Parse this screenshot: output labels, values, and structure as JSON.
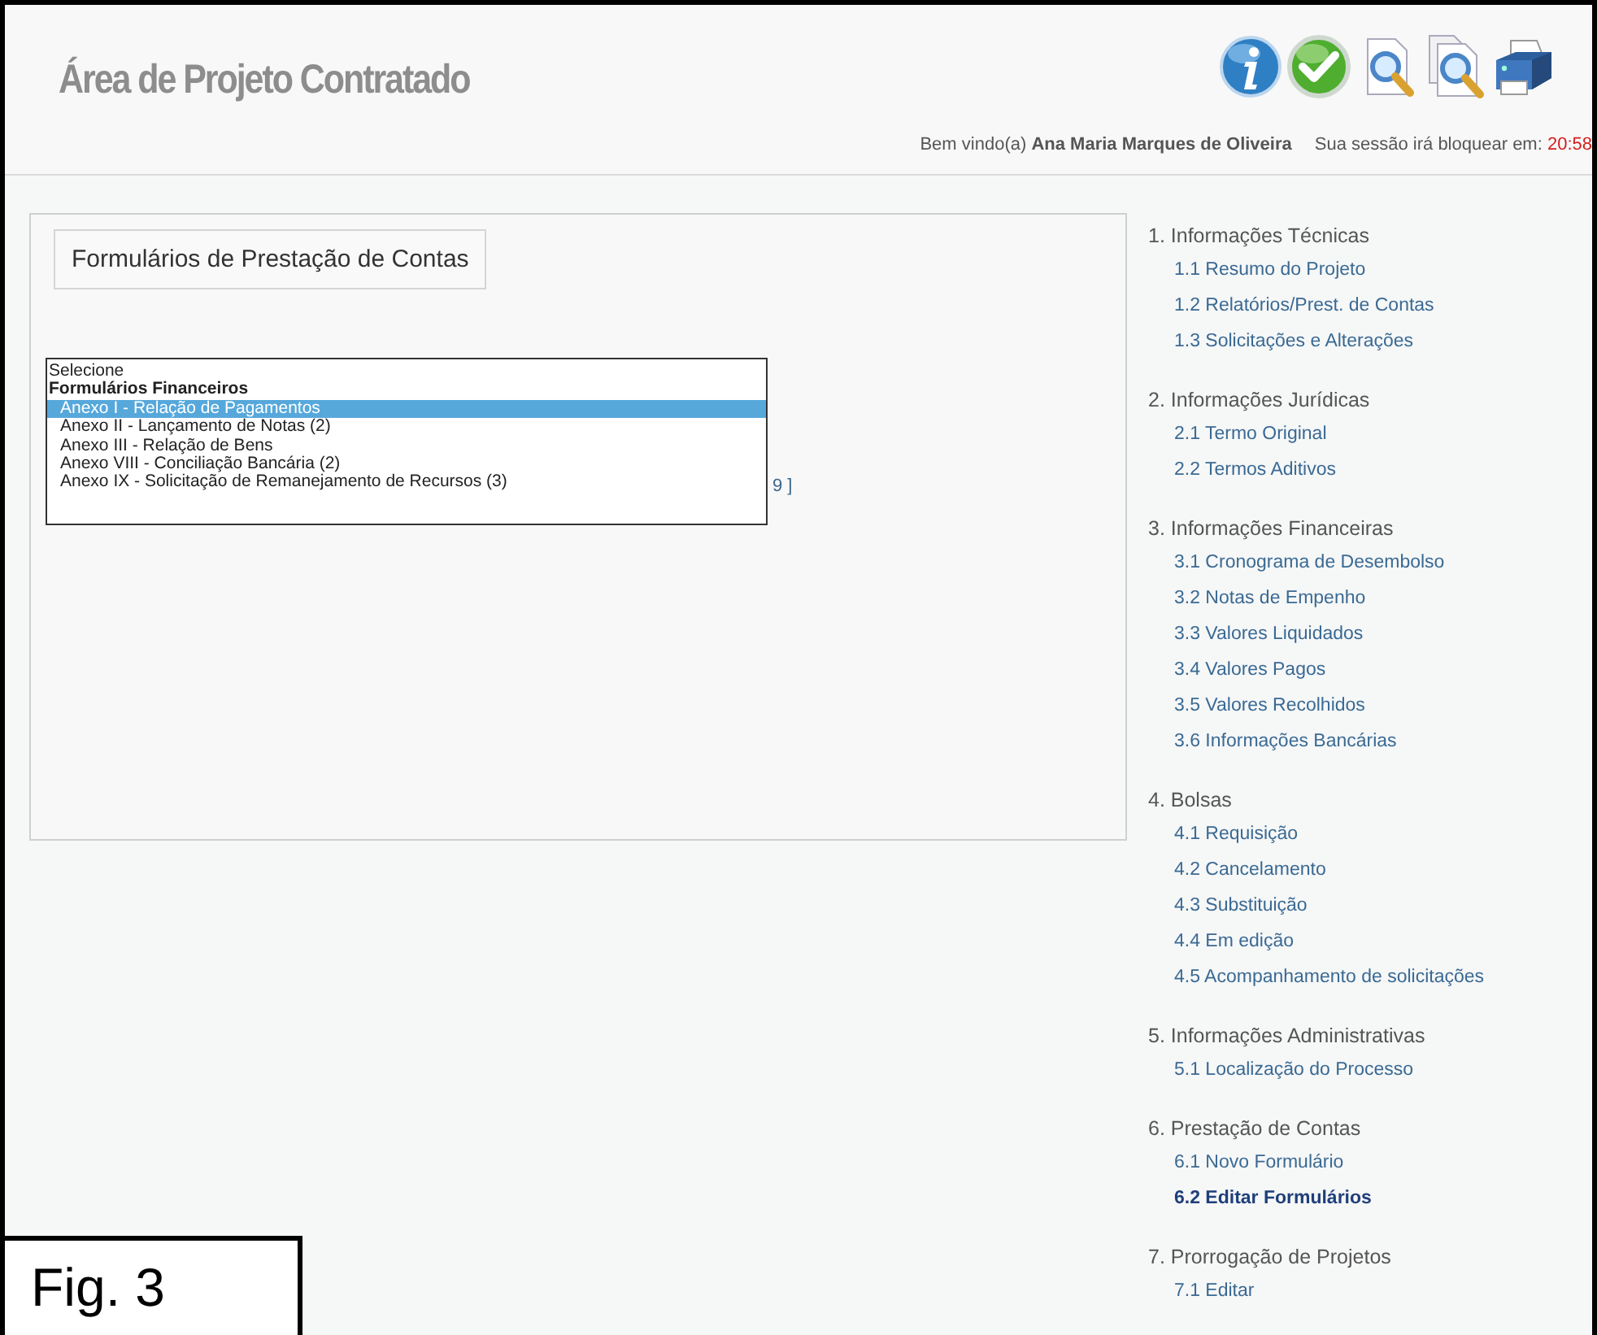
{
  "header": {
    "title": "Área de Projeto Contratado",
    "toolbar": [
      {
        "kind": "info"
      },
      {
        "kind": "check"
      },
      {
        "kind": "zoom"
      },
      {
        "kind": "zoom-pages"
      },
      {
        "kind": "print"
      }
    ],
    "welcome": "Bem vindo(a) **Ana Maria Marques de Oliveira**",
    "session_label": "Sua sessão irá bloquear em:",
    "session_time": "20:58"
  },
  "form_panel": {
    "legend": "Formulários de Prestação de Contas",
    "listbox": [
      {
        "kind": "option",
        "label": "Selecione",
        "selected": false
      },
      {
        "kind": "group",
        "label": "Formulários Financeiros",
        "selected": false
      },
      {
        "kind": "suboption",
        "label": "Anexo I - Relação de Pagamentos",
        "selected": true
      },
      {
        "kind": "suboption",
        "label": "Anexo II - Lançamento de Notas (2)",
        "selected": false
      },
      {
        "kind": "suboption",
        "label": "Anexo III - Relação de Bens",
        "selected": false
      },
      {
        "kind": "suboption",
        "label": "Anexo VIII - Conciliação Bancária (2)",
        "selected": false
      },
      {
        "kind": "suboption",
        "label": "Anexo IX - Solicitação de Remanejamento de Recursos (3)",
        "selected": false
      }
    ],
    "partial_text": "9 ]"
  },
  "sidebar": [
    {
      "heading": "1. Informações Técnicas",
      "items": [
        {
          "label": "1.1 Resumo do Projeto",
          "selected": false
        },
        {
          "label": "1.2 Relatórios/Prest. de Contas",
          "selected": false
        },
        {
          "label": "1.3 Solicitações e Alterações",
          "selected": false
        }
      ]
    },
    {
      "heading": "2. Informações Jurídicas",
      "items": [
        {
          "label": "2.1 Termo Original",
          "selected": false
        },
        {
          "label": "2.2 Termos Aditivos",
          "selected": false
        }
      ]
    },
    {
      "heading": "3. Informações Financeiras",
      "items": [
        {
          "label": "3.1 Cronograma de Desembolso",
          "selected": false
        },
        {
          "label": "3.2 Notas de Empenho",
          "selected": false
        },
        {
          "label": "3.3 Valores Liquidados",
          "selected": false
        },
        {
          "label": "3.4 Valores Pagos",
          "selected": false
        },
        {
          "label": "3.5 Valores Recolhidos",
          "selected": false
        },
        {
          "label": "3.6 Informações Bancárias",
          "selected": false
        }
      ]
    },
    {
      "heading": "4. Bolsas",
      "items": [
        {
          "label": "4.1 Requisição",
          "selected": false
        },
        {
          "label": "4.2 Cancelamento",
          "selected": false
        },
        {
          "label": "4.3 Substituição",
          "selected": false
        },
        {
          "label": "4.4 Em edição",
          "selected": false
        },
        {
          "label": "4.5 Acompanhamento de solicitações",
          "selected": false
        }
      ]
    },
    {
      "heading": "5. Informações Administrativas",
      "items": [
        {
          "label": "5.1 Localização do Processo",
          "selected": false
        }
      ]
    },
    {
      "heading": "6. Prestação de Contas",
      "items": [
        {
          "label": "6.1 Novo Formulário",
          "selected": false
        },
        {
          "label": "6.2 Editar Formulários",
          "selected": true
        }
      ]
    },
    {
      "heading": "7. Prorrogação de Projetos",
      "items": [
        {
          "label": "7.1 Editar",
          "selected": false
        }
      ]
    }
  ],
  "figure_label": "Fig. 3"
}
